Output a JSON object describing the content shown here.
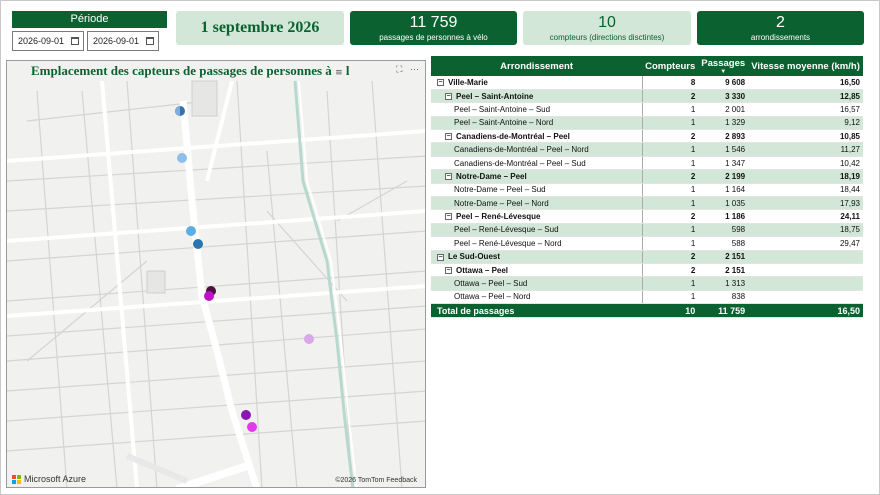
{
  "filter": {
    "header": "Période",
    "start_date": "2026-09-01",
    "end_date": "2026-09-01"
  },
  "kpis": {
    "date": "1 septembre 2026",
    "passages_value": "11 759",
    "passages_label": "passages de personnes à vélo",
    "compteurs_value": "10",
    "compteurs_label": "compteurs (directions disctintes)",
    "arrond_value": "2",
    "arrond_label": "arrondissements"
  },
  "map": {
    "title": "Emplacement des capteurs de passages de personnes à",
    "title_tail": "l",
    "brand": "Microsoft Azure",
    "attribution": "©2026 TomTom Feedback",
    "markers": [
      {
        "color": "#3e6fa8",
        "half": true
      },
      {
        "color": "#8cc0ea",
        "half": false
      },
      {
        "color": "#5aaee6",
        "half": false
      },
      {
        "color": "#2a75b0",
        "half": false
      },
      {
        "color": "#4a1040",
        "half": false
      },
      {
        "color": "#c011c8",
        "half": false
      },
      {
        "color": "#d8a8e8",
        "half": false
      },
      {
        "color": "#8a18b0",
        "half": false
      },
      {
        "color": "#e23ae8",
        "half": false
      }
    ]
  },
  "table": {
    "headers": [
      "Arrondissement",
      "Compteurs",
      "Passages",
      "Vitesse moyenne (km/h)"
    ],
    "rows": [
      {
        "level": 0,
        "label": "Ville-Marie",
        "compteurs": "8",
        "passages": "9 608",
        "vitesse": "16,50",
        "bold": true,
        "alt": false
      },
      {
        "level": 1,
        "label": "Peel – Saint-Antoine",
        "compteurs": "2",
        "passages": "3 330",
        "vitesse": "12,85",
        "bold": true,
        "alt": true
      },
      {
        "level": 2,
        "label": "Peel – Saint-Antoine – Sud",
        "compteurs": "1",
        "passages": "2 001",
        "vitesse": "16,57",
        "bold": false,
        "alt": false
      },
      {
        "level": 2,
        "label": "Peel – Saint-Antoine – Nord",
        "compteurs": "1",
        "passages": "1 329",
        "vitesse": "9,12",
        "bold": false,
        "alt": true
      },
      {
        "level": 1,
        "label": "Canadiens-de-Montréal – Peel",
        "compteurs": "2",
        "passages": "2 893",
        "vitesse": "10,85",
        "bold": true,
        "alt": false
      },
      {
        "level": 2,
        "label": "Canadiens-de-Montréal – Peel – Nord",
        "compteurs": "1",
        "passages": "1 546",
        "vitesse": "11,27",
        "bold": false,
        "alt": true
      },
      {
        "level": 2,
        "label": "Canadiens-de-Montréal – Peel – Sud",
        "compteurs": "1",
        "passages": "1 347",
        "vitesse": "10,42",
        "bold": false,
        "alt": false
      },
      {
        "level": 1,
        "label": "Notre-Dame – Peel",
        "compteurs": "2",
        "passages": "2 199",
        "vitesse": "18,19",
        "bold": true,
        "alt": true
      },
      {
        "level": 2,
        "label": "Notre-Dame – Peel – Sud",
        "compteurs": "1",
        "passages": "1 164",
        "vitesse": "18,44",
        "bold": false,
        "alt": false
      },
      {
        "level": 2,
        "label": "Notre-Dame – Peel – Nord",
        "compteurs": "1",
        "passages": "1 035",
        "vitesse": "17,93",
        "bold": false,
        "alt": true
      },
      {
        "level": 1,
        "label": "Peel – René-Lévesque",
        "compteurs": "2",
        "passages": "1 186",
        "vitesse": "24,11",
        "bold": true,
        "alt": false
      },
      {
        "level": 2,
        "label": "Peel – René-Lévesque – Sud",
        "compteurs": "1",
        "passages": "598",
        "vitesse": "18,75",
        "bold": false,
        "alt": true
      },
      {
        "level": 2,
        "label": "Peel – René-Lévesque – Nord",
        "compteurs": "1",
        "passages": "588",
        "vitesse": "29,47",
        "bold": false,
        "alt": false
      },
      {
        "level": 0,
        "label": "Le Sud-Ouest",
        "compteurs": "2",
        "passages": "2 151",
        "vitesse": "",
        "bold": true,
        "alt": true
      },
      {
        "level": 1,
        "label": "Ottawa – Peel",
        "compteurs": "2",
        "passages": "2 151",
        "vitesse": "",
        "bold": true,
        "alt": false
      },
      {
        "level": 2,
        "label": "Ottawa – Peel – Sud",
        "compteurs": "1",
        "passages": "1 313",
        "vitesse": "",
        "bold": false,
        "alt": true
      },
      {
        "level": 2,
        "label": "Ottawa – Peel – Nord",
        "compteurs": "1",
        "passages": "838",
        "vitesse": "",
        "bold": false,
        "alt": false
      }
    ],
    "total": {
      "label": "Total de passages",
      "compteurs": "10",
      "passages": "11 759",
      "vitesse": "16,50"
    }
  },
  "colors": {
    "brand_green": "#0b6230",
    "light_green": "#d2e7d8"
  }
}
